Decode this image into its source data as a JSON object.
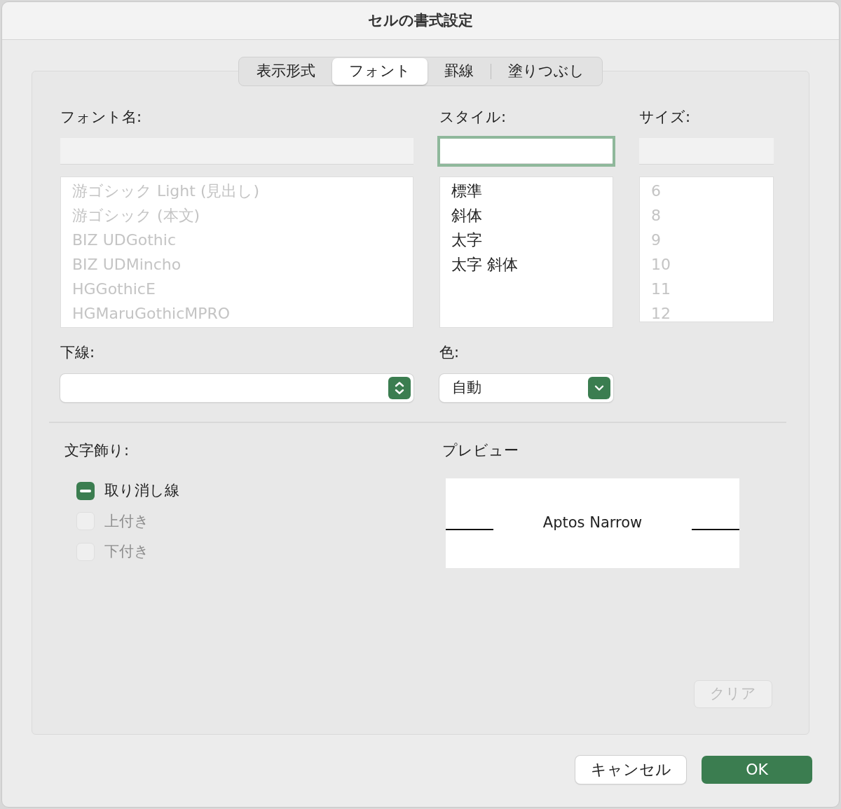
{
  "window": {
    "title": "セルの書式設定"
  },
  "tabs": [
    {
      "label": "表示形式",
      "selected": false
    },
    {
      "label": "フォント",
      "selected": true
    },
    {
      "label": "罫線",
      "selected": false
    },
    {
      "label": "塗りつぶし",
      "selected": false
    }
  ],
  "font_name": {
    "label": "フォント名:",
    "disabled": true,
    "options": [
      "游ゴシック Light (見出し)",
      "游ゴシック (本文)",
      "BIZ UDGothic",
      "BIZ UDMincho",
      "HGGothicE",
      "HGMaruGothicMPRO"
    ]
  },
  "style": {
    "label": "スタイル:",
    "disabled": false,
    "focused": true,
    "options": [
      "標準",
      "斜体",
      "太字",
      "太字 斜体"
    ]
  },
  "size": {
    "label": "サイズ:",
    "disabled": true,
    "options": [
      "6",
      "8",
      "9",
      "10",
      "11",
      "12"
    ]
  },
  "underline": {
    "label": "下線:",
    "kind": "stepper"
  },
  "color": {
    "label": "色:",
    "kind": "dropdown",
    "value": "自動"
  },
  "effects": {
    "label": "文字飾り:",
    "items": [
      {
        "label": "取り消し線",
        "checked": true,
        "mixed": true,
        "disabled": false
      },
      {
        "label": "上付き",
        "checked": false,
        "disabled": true
      },
      {
        "label": "下付き",
        "checked": false,
        "disabled": true
      }
    ]
  },
  "preview": {
    "label": "プレビュー",
    "sample": "Aptos Narrow"
  },
  "clear_button": {
    "label": "クリア",
    "disabled": true
  },
  "buttons": [
    {
      "label": "キャンセル",
      "kind": "secondary"
    },
    {
      "label": "OK",
      "kind": "primary"
    }
  ]
}
